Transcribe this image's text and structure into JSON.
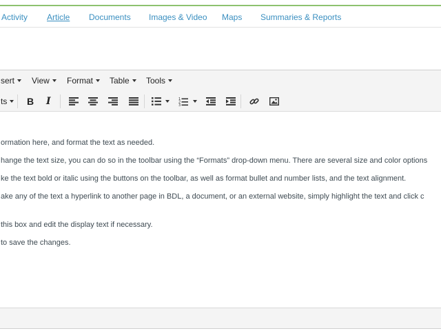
{
  "tabs": [
    {
      "label": "Activity"
    },
    {
      "label": "Article"
    },
    {
      "label": "Documents"
    },
    {
      "label": "Images & Video"
    },
    {
      "label": "Maps"
    },
    {
      "label": "Summaries & Reports"
    }
  ],
  "editor": {
    "menubar": [
      {
        "label": "sert"
      },
      {
        "label": "View"
      },
      {
        "label": "Format"
      },
      {
        "label": "Table"
      },
      {
        "label": "Tools"
      }
    ],
    "toolbar": {
      "formats_label": "ts",
      "bold_label": "B",
      "italic_label": "I"
    },
    "content": [
      "ormation here, and format the text as needed.",
      "hange the text size, you can do so in the toolbar using the “Formats” drop-down menu. There are several size and color options",
      "ke the text bold or italic using the buttons on the toolbar, as well as format bullet and number lists, and the text alignment.",
      "ake any of the text a hyperlink to another page in BDL, a document, or an external website, simply highlight the text and click c",
      "this box and edit the display text if necessary.",
      " to save the changes."
    ]
  },
  "colors": {
    "accent_line": "#8dc26f",
    "tab_link": "#3a8fc0",
    "text": "#3e4a52"
  },
  "icons": [
    "align-left-icon",
    "align-center-icon",
    "align-right-icon",
    "align-justify-icon",
    "bullet-list-icon",
    "numbered-list-icon",
    "outdent-icon",
    "indent-icon",
    "link-icon",
    "image-icon"
  ]
}
